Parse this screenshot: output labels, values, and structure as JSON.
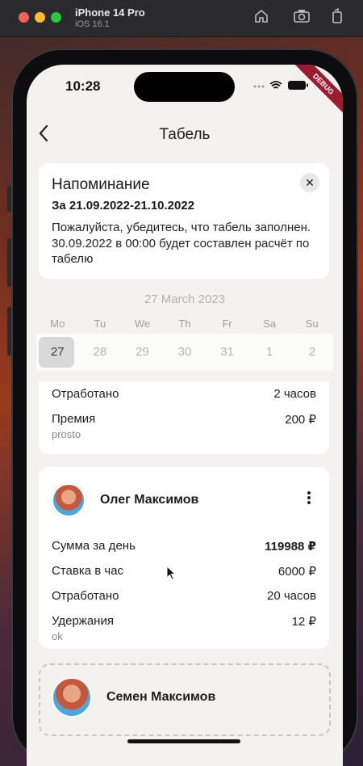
{
  "simulator": {
    "device": "iPhone 14 Pro",
    "os": "iOS 16.1"
  },
  "status_bar": {
    "time": "10:28",
    "icons": "••• ᯤ ▬",
    "debug": "DEBUG"
  },
  "nav": {
    "title": "Табель",
    "back_icon": "chevron-left-icon"
  },
  "reminder": {
    "title": "Напоминание",
    "period": "За 21.09.2022-21.10.2022",
    "text": "Пожалуйста, убедитесь, что табель заполнен. 30.09.2022 в 00:00 будет составлен расчёт по табелю",
    "close_icon": "close-icon"
  },
  "calendar": {
    "current_date": "27 March 2023",
    "weekdays": [
      "Mo",
      "Tu",
      "We",
      "Th",
      "Fr",
      "Sa",
      "Su"
    ],
    "days": [
      "27",
      "28",
      "29",
      "30",
      "31",
      "1",
      "2"
    ],
    "selected_index": 0
  },
  "summary_prev": {
    "worked_label": "Отработано",
    "worked_value": "2 часов",
    "bonus_label": "Премия",
    "bonus_value": "200 ₽",
    "note": "prosto"
  },
  "employee1": {
    "name": "Олег Максимов",
    "day_sum_label": "Сумма за день",
    "day_sum_value": "119988 ₽",
    "rate_label": "Ставка в час",
    "rate_value": "6000 ₽",
    "worked_label": "Отработано",
    "worked_value": "20 часов",
    "deductions_label": "Удержания",
    "deductions_value": "12 ₽",
    "note": "ok",
    "menu_icon": "more-vertical-icon"
  },
  "employee2": {
    "name": "Семен Максимов"
  },
  "colors": {
    "background": "#f3f2ee",
    "card": "#ffffff",
    "selected_day": "#d9d9d9",
    "debug_ribbon": "#9b1b30"
  }
}
